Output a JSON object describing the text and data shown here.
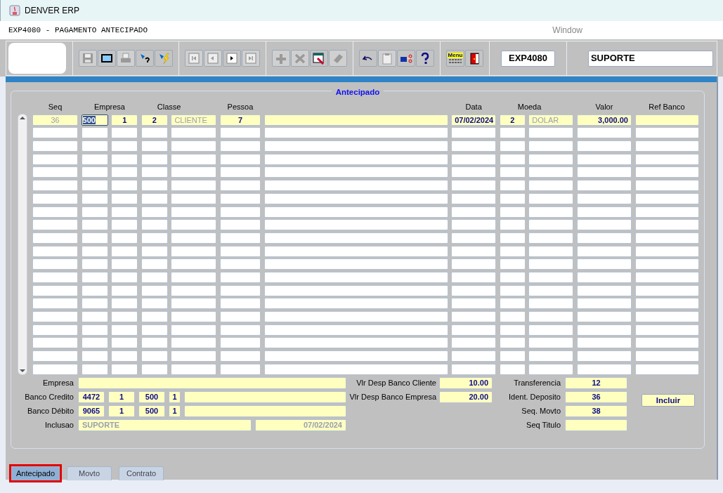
{
  "window": {
    "title": "DENVER ERP"
  },
  "form_title": "EXP4080 - PAGAMENTO ANTECIPADO",
  "menu": [
    "Window"
  ],
  "toolbar": {
    "groups": [
      [
        {
          "kind": "save",
          "disabled": true
        },
        {
          "kind": "window",
          "disabled": false
        },
        {
          "kind": "print",
          "disabled": true
        },
        {
          "kind": "query",
          "disabled": false
        },
        {
          "kind": "execute",
          "disabled": false
        }
      ],
      [
        {
          "kind": "first",
          "disabled": true
        },
        {
          "kind": "previous",
          "disabled": true
        },
        {
          "kind": "next",
          "disabled": false
        },
        {
          "kind": "last",
          "disabled": true
        }
      ],
      [
        {
          "kind": "insert",
          "disabled": true
        },
        {
          "kind": "delete",
          "disabled": true
        },
        {
          "kind": "edit",
          "disabled": false
        },
        {
          "kind": "clear",
          "disabled": true
        }
      ],
      [
        {
          "kind": "undo",
          "disabled": false
        },
        {
          "kind": "clipboard",
          "disabled": true
        },
        {
          "kind": "hand",
          "disabled": false
        },
        {
          "kind": "help",
          "disabled": false
        }
      ],
      [
        {
          "kind": "menu",
          "label": "Menu",
          "disabled": false
        },
        {
          "kind": "exit",
          "disabled": false
        }
      ]
    ],
    "form_code": "EXP4080",
    "user": "SUPORTE"
  },
  "section_title": "Antecipado",
  "table": {
    "columns": [
      "Seq",
      "Empresa",
      "",
      "Classe",
      "",
      "Pessoa",
      "",
      "Data",
      "Moeda",
      "",
      "Valor",
      "Ref Banco"
    ],
    "rows": [
      {
        "cells": [
          {
            "text": "36",
            "readonly": true,
            "selected": false
          },
          {
            "text": "500",
            "readonly": false,
            "selected": true
          },
          {
            "text": "1",
            "readonly": false,
            "selected": false
          },
          {
            "text": "2",
            "readonly": false,
            "selected": false
          },
          {
            "text": "CLIENTE",
            "readonly": true,
            "selected": false
          },
          {
            "text": "7",
            "readonly": false,
            "selected": false
          },
          {
            "selected": false
          },
          {
            "text": "07/02/2024",
            "readonly": false,
            "selected": false
          },
          {
            "text": "2",
            "readonly": false,
            "selected": false
          },
          {
            "text": "DOLAR",
            "readonly": true,
            "selected": false
          },
          {
            "text": "3,000.00",
            "readonly": false,
            "selected": false
          },
          {
            "selected": false
          }
        ]
      }
    ]
  },
  "details": [
    {
      "label": "Empresa",
      "fields": [
        {
          "kind": "name"
        }
      ],
      "label2": "Vlr Desp Banco Cliente",
      "value2": "10.00",
      "label3": "Transferencia",
      "value3": "12"
    },
    {
      "label": "Banco Credito",
      "fields": [
        {
          "kind": "code",
          "text": "4472"
        },
        {
          "kind": "code",
          "text": "1"
        },
        {
          "kind": "code",
          "text": "500"
        },
        {
          "kind": "digit",
          "text": "1"
        },
        {
          "kind": "name"
        }
      ],
      "label2": "Vlr Desp Banco Empresa",
      "value2": "20.00",
      "label3": "Ident. Deposito",
      "value3": "36",
      "button": "Incluir"
    },
    {
      "label": "Banco Débito",
      "fields": [
        {
          "kind": "code",
          "text": "9065"
        },
        {
          "kind": "code",
          "text": "1"
        },
        {
          "kind": "code",
          "text": "500"
        },
        {
          "kind": "digit",
          "text": "1"
        },
        {
          "kind": "name"
        }
      ],
      "label3": "Seq. Movto",
      "value3": "38"
    },
    {
      "label": "Inclusao",
      "fields": [
        {
          "kind": "user",
          "text": "SUPORTE",
          "readonly": true
        },
        {
          "kind": "date",
          "text": "07/02/2024",
          "readonly": true
        }
      ],
      "label3": "Seq Titulo"
    }
  ],
  "tabs": [
    {
      "label": "Antecipado",
      "selected": true
    },
    {
      "label": "Movto",
      "selected": false
    },
    {
      "label": "Contrato",
      "selected": false
    }
  ]
}
